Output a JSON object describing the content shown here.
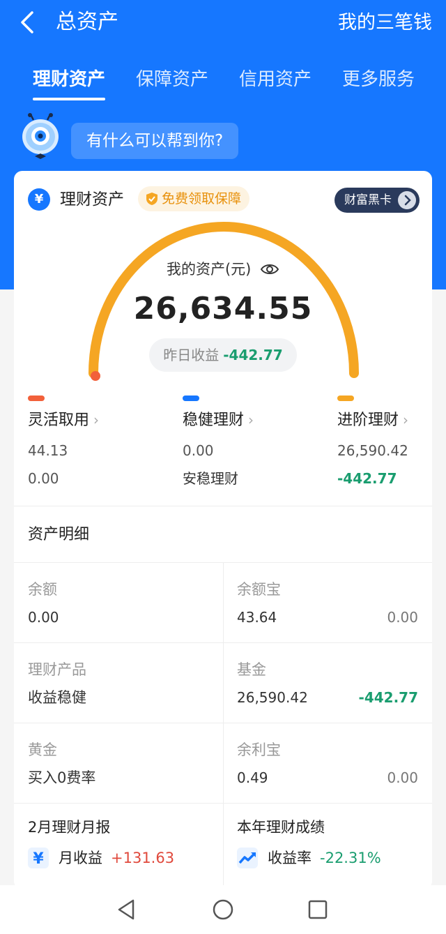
{
  "header": {
    "title": "总资产",
    "right_link": "我的三笔钱"
  },
  "tabs": [
    {
      "label": "理财资产",
      "active": true
    },
    {
      "label": "保障资产",
      "active": false
    },
    {
      "label": "信用资产",
      "active": false
    },
    {
      "label": "更多服务",
      "active": false
    }
  ],
  "assistant": {
    "prompt": "有什么可以帮到你?"
  },
  "card": {
    "yen_badge": "¥",
    "title": "理财资产",
    "promo": "免费领取保障",
    "black_card": "财富黑卡",
    "asset_label": "我的资产(元)",
    "asset_value": "26,634.55",
    "yesterday_label": "昨日收益",
    "yesterday_value": "-442.77"
  },
  "categories": [
    {
      "name": "灵活取用",
      "color": "#f2603a",
      "line1": "44.13",
      "line2": "0.00"
    },
    {
      "name": "稳健理财",
      "color": "#1677ff",
      "line1": "0.00",
      "line2": "安稳理财"
    },
    {
      "name": "进阶理财",
      "color": "#f5a623",
      "line1": "26,590.42",
      "line2": "-442.77"
    }
  ],
  "details": {
    "title": "资产明细",
    "cells": [
      {
        "label": "余额",
        "value": "0.00",
        "right": ""
      },
      {
        "label": "余额宝",
        "value": "43.64",
        "right": "0.00"
      },
      {
        "label": "理财产品",
        "value": "收益稳健",
        "right": ""
      },
      {
        "label": "基金",
        "value": "26,590.42",
        "right": "-442.77"
      },
      {
        "label": "黄金",
        "value": "买入0费率",
        "right": ""
      },
      {
        "label": "余利宝",
        "value": "0.49",
        "right": "0.00"
      }
    ]
  },
  "reports": {
    "monthly_title": "2月理财月报",
    "monthly_label": "月收益",
    "monthly_value": "+131.63",
    "yearly_title": "本年理财成绩",
    "yearly_label": "收益率",
    "yearly_value": "-22.31%"
  },
  "colors": {
    "brand_blue": "#1677ff",
    "gauge_orange": "#f5a623",
    "negative_green": "#1a9d6f",
    "positive_red": "#e0493c"
  }
}
